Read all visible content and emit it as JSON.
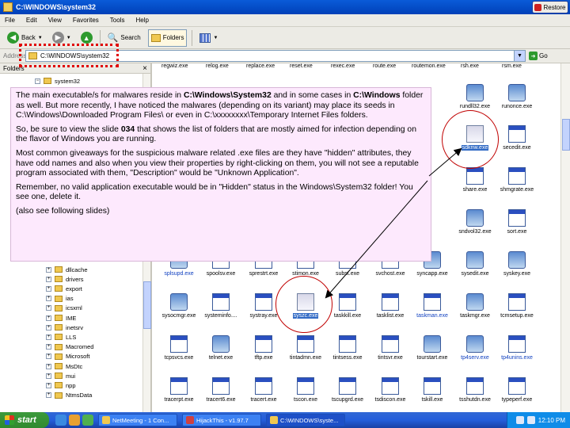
{
  "window": {
    "title": "C:\\WINDOWS\\system32",
    "restore_label": "Restore"
  },
  "menu": [
    "File",
    "Edit",
    "View",
    "Favorites",
    "Tools",
    "Help"
  ],
  "toolbar": {
    "back": "Back",
    "search": "Search",
    "folders": "Folders"
  },
  "address": {
    "label": "Address",
    "value": "C:\\WINDOWS\\system32",
    "go": "Go"
  },
  "folders_pane": {
    "title": "Folders",
    "root": "system32",
    "items": [
      "dllcache",
      "drivers",
      "export",
      "ias",
      "icsxml",
      "IME",
      "inetsrv",
      "LLS",
      "Macromed",
      "Microsoft",
      "MsDtc",
      "mui",
      "npp",
      "NtmsData"
    ]
  },
  "top_row": [
    "regwiz.exe",
    "relog.exe",
    "replace.exe",
    "reset.exe",
    "rexec.exe",
    "route.exe",
    "routemon.exe",
    "rsh.exe",
    "rsm.exe"
  ],
  "files": [
    {
      "name": "rundll32.exe",
      "color": "black"
    },
    {
      "name": "runonce.exe",
      "color": "black"
    },
    {
      "name": "sdknw.exe",
      "color": "selected"
    },
    {
      "name": "secedit.exe",
      "color": "black"
    },
    {
      "name": "share.exe",
      "color": "black"
    },
    {
      "name": "shmgrate.exe",
      "color": "black"
    },
    {
      "name": "sndvol32.exe",
      "color": "black"
    },
    {
      "name": "sort.exe",
      "color": "black"
    },
    {
      "name": "splsupd.exe",
      "color": "blue"
    },
    {
      "name": "spoolsv.exe",
      "color": "black"
    },
    {
      "name": "sprestrt.exe",
      "color": "black"
    },
    {
      "name": "stimon.exe",
      "color": "black"
    },
    {
      "name": "subst.exe",
      "color": "black"
    },
    {
      "name": "svchost.exe",
      "color": "black"
    },
    {
      "name": "syncapp.exe",
      "color": "black"
    },
    {
      "name": "sysedit.exe",
      "color": "black"
    },
    {
      "name": "syskey.exe",
      "color": "black"
    },
    {
      "name": "sysocmgr.exe",
      "color": "black"
    },
    {
      "name": "systeminfo....",
      "color": "black"
    },
    {
      "name": "systray.exe",
      "color": "black"
    },
    {
      "name": "syszc.exe",
      "color": "selected"
    },
    {
      "name": "taskkill.exe",
      "color": "black"
    },
    {
      "name": "tasklist.exe",
      "color": "black"
    },
    {
      "name": "taskman.exe",
      "color": "blue"
    },
    {
      "name": "taskmgr.exe",
      "color": "black"
    },
    {
      "name": "tcmsetup.exe",
      "color": "black"
    },
    {
      "name": "tcpsvcs.exe",
      "color": "black"
    },
    {
      "name": "telnet.exe",
      "color": "black"
    },
    {
      "name": "tftp.exe",
      "color": "black"
    },
    {
      "name": "tintadmn.exe",
      "color": "black"
    },
    {
      "name": "tintsess.exe",
      "color": "black"
    },
    {
      "name": "tintsvr.exe",
      "color": "black"
    },
    {
      "name": "tourstart.exe",
      "color": "black"
    },
    {
      "name": "tp4serv.exe",
      "color": "blue"
    },
    {
      "name": "tp4unins.exe",
      "color": "blue"
    },
    {
      "name": "tracerpt.exe",
      "color": "black"
    },
    {
      "name": "tracert6.exe",
      "color": "black"
    },
    {
      "name": "tracert.exe",
      "color": "black"
    },
    {
      "name": "tscon.exe",
      "color": "black"
    },
    {
      "name": "tscupgrd.exe",
      "color": "black"
    },
    {
      "name": "tsdiscon.exe",
      "color": "black"
    },
    {
      "name": "tskill.exe",
      "color": "black"
    },
    {
      "name": "tsshutdn.exe",
      "color": "black"
    },
    {
      "name": "typeperf.exe",
      "color": "black"
    }
  ],
  "overlay": {
    "p1_a": "The main executable/s for malwares reside in ",
    "p1_b": "C:\\Windows\\System32",
    "p1_c": " and in some cases in ",
    "p1_d": "C:\\Windows",
    "p1_e": " folder as well. But more recently, I have noticed the malwares (depending on its variant) may place its seeds in C:\\Windows\\Downloaded Program Files\\ or even in C:\\xxxxxxxx\\Temporary Internet Files folders.",
    "p2_a": "So, be sure to view the slide ",
    "p2_b": "034",
    "p2_c": " that shows the list of folders that are mostly aimed for infection depending on the flavor of Windows you are running.",
    "p3": "Most common giveaways for the suspicious malware related .exe files are they have \"hidden\" attributes, they have odd names and also when you view their properties by right-clicking on them, you will not see a reputable program associated with them, \"Description\" would be \"Unknown Application\".",
    "p4": "Remember, no valid application executable would be in \"Hidden\" status in the Windows\\System32  folder! You see one, delete it.",
    "p5": "(also see following slides)"
  },
  "taskbar": {
    "start": "start",
    "tasks": [
      "NetMeeting - 1 Con...",
      "HijackThis - v1.97.7",
      "C:\\WINDOWS\\syste..."
    ],
    "clock": "12:10 PM"
  },
  "colors": {
    "title_blue": "#0a5bd8",
    "overlay_pink": "#fde9fd",
    "circle_red": "#c00000",
    "selection_blue": "#316ac5",
    "taskbar_blue": "#245edb",
    "start_green": "#3c9a3c"
  }
}
